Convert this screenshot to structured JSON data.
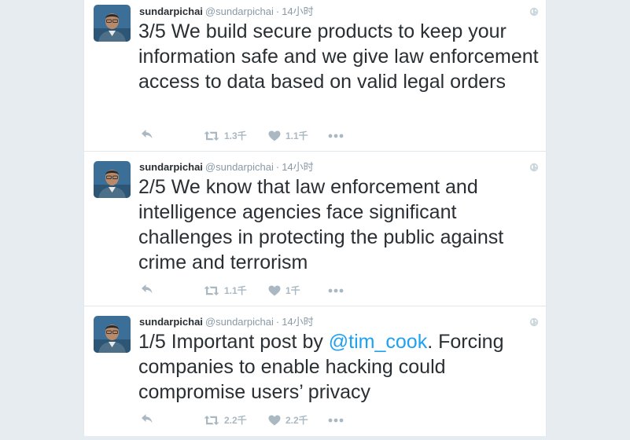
{
  "tweets": [
    {
      "name": "sundarpichai",
      "handle": "@sundarpichai",
      "dot": "·",
      "time": "14小时",
      "text_before": "3/5 We build secure products to keep your information safe and we give law enforcement access to data based on valid legal orders",
      "mention": "",
      "text_after": "",
      "retweets": "1.3千",
      "likes": "1.1千"
    },
    {
      "name": "sundarpichai",
      "handle": "@sundarpichai",
      "dot": "·",
      "time": "14小时",
      "text_before": "2/5 We know that law enforcement and intelligence agencies face significant challenges in protecting the public against crime and terrorism",
      "mention": "",
      "text_after": "",
      "retweets": "1.1千",
      "likes": "1千"
    },
    {
      "name": "sundarpichai",
      "handle": "@sundarpichai",
      "dot": "·",
      "time": "14小时",
      "text_before": "1/5 Important post by ",
      "mention": "@tim_cook",
      "text_after": ". Forcing companies to enable hacking could compromise users’ privacy",
      "retweets": "2.2千",
      "likes": "2.2千"
    }
  ],
  "colors": {
    "page_background": "#e6ecf0",
    "text": "#292f33",
    "muted": "#8899a6",
    "link": "#1da1f2",
    "action_icon": "#aab8c2"
  },
  "icons": [
    "avatar-photo",
    "globe-icon",
    "reply-icon",
    "retweet-icon",
    "heart-icon",
    "more-icon"
  ]
}
